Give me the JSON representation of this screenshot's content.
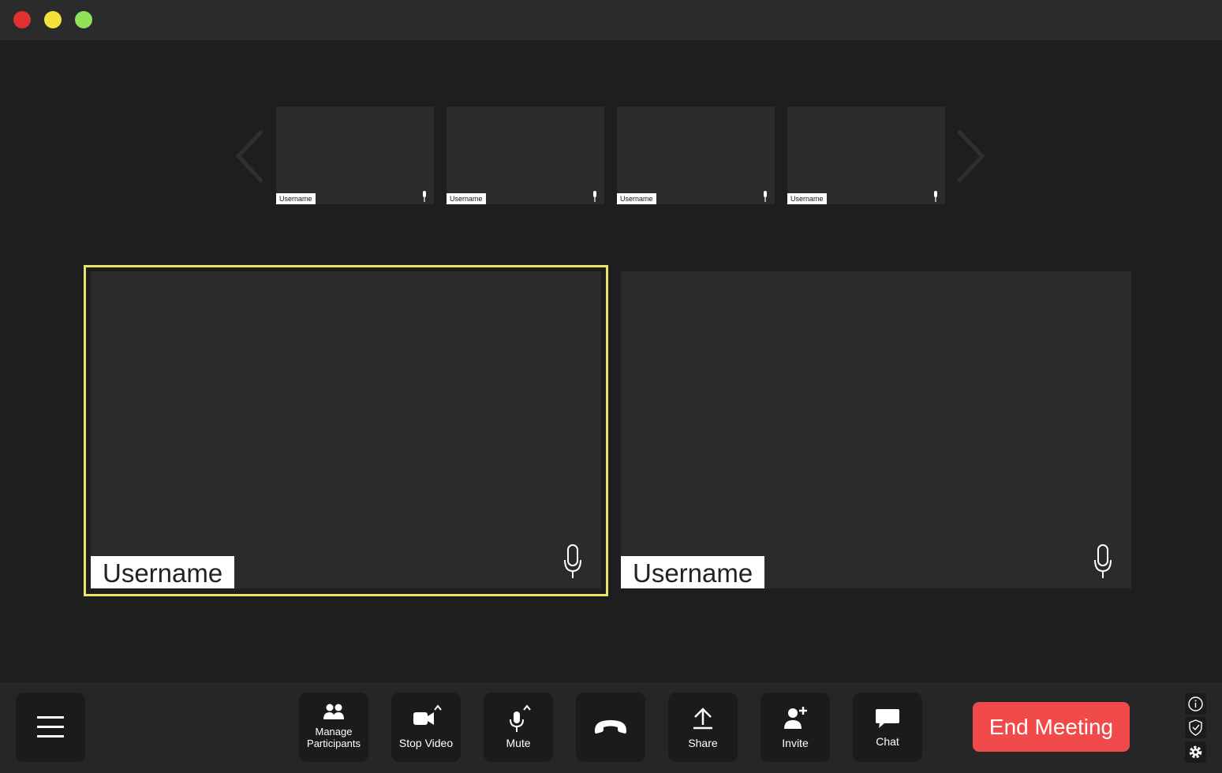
{
  "window": {
    "controls": [
      "close",
      "minimize",
      "maximize"
    ],
    "colors": {
      "close": "#e0312f",
      "minimize": "#f2e23a",
      "maximize": "#8fe25a"
    }
  },
  "thumbnails": [
    {
      "username": "Username"
    },
    {
      "username": "Username"
    },
    {
      "username": "Username"
    },
    {
      "username": "Username"
    }
  ],
  "main_tiles": [
    {
      "username": "Username",
      "active_speaker": true
    },
    {
      "username": "Username",
      "active_speaker": false
    }
  ],
  "toolbar": {
    "menu_icon": "hamburger-menu-icon",
    "manage_participants_label": "Manage\nParticipants",
    "stop_video_label": "Stop Video",
    "mute_label": "Mute",
    "hangup_icon": "phone-hangup-icon",
    "share_label": "Share",
    "invite_label": "Invite",
    "chat_label": "Chat",
    "end_meeting_label": "End Meeting",
    "side_icons": [
      "info-icon",
      "shield-icon",
      "gear-icon"
    ]
  },
  "colors": {
    "accent_active": "#efe46a",
    "end_meeting": "#f04a4a"
  }
}
